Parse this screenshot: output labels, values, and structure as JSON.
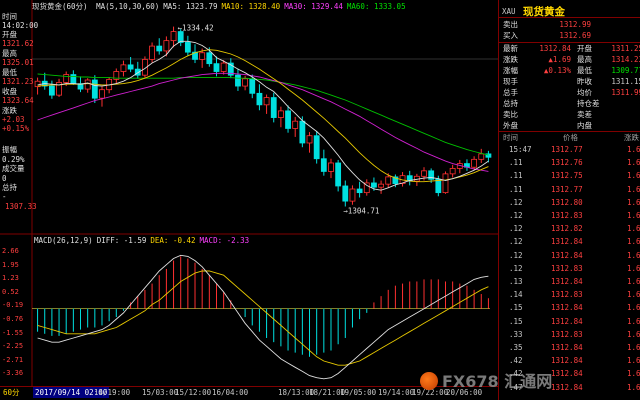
{
  "header": {
    "title": "现货黄金(60分)",
    "ma_labels": [
      {
        "text": "MA(5,10,30,60)",
        "color": "#e0e0e0"
      },
      {
        "text": "MA5: 1323.79",
        "color": "#e0e0e0"
      },
      {
        "text": "MA10: 1328.40",
        "color": "#ffd700"
      },
      {
        "text": "MA30: 1329.44",
        "color": "#ff40ff"
      },
      {
        "text": "MA60: 1333.05",
        "color": "#00e000"
      }
    ]
  },
  "left_info": {
    "time_label": "时间",
    "time_value": "14:02:00",
    "open_label": "开盘",
    "open_value": "1321.62",
    "high_label": "最高",
    "high_value": "1325.01",
    "low_label": "最低",
    "low_value": "1321.23",
    "close_label": "收盘",
    "close_value": "1323.64",
    "change_label": "涨跌",
    "change_value": "+2.03",
    "pct_value": "+0.15%",
    "amplitude_label": "振幅",
    "amplitude_value": "0.29%",
    "volume_label": "成交量",
    "volume_value": "0",
    "hold_label": "总持",
    "hold_value": "-",
    "marker_price": "1307.33"
  },
  "price_axis": [
    "1335.31",
    "1321.62",
    "1325.01",
    "1321.23",
    "1323.64",
    "+2.03",
    "+0.15%",
    "0.29%"
  ],
  "chart_annotations": {
    "peak": "1334.42",
    "trough": "1304.71"
  },
  "macd": {
    "header": [
      {
        "text": "MACD(26,12,9)",
        "color": "#e0e0e0"
      },
      {
        "text": "DIFF: -1.59",
        "color": "#e0e0e0"
      },
      {
        "text": "DEA: -0.42",
        "color": "#ffd700"
      },
      {
        "text": "MACD: -2.33",
        "color": "#ff40ff"
      }
    ],
    "axis": [
      "2.66",
      "1.95",
      "1.23",
      "0.52",
      "-0.19",
      "-0.76",
      "-1.55",
      "-2.25",
      "-2.71",
      "-3.36"
    ]
  },
  "footer": {
    "period": "60分",
    "cursor_date": "2017/09/14 02:00",
    "x_labels": [
      "14/19:00",
      "15/03:00",
      "15/12:00",
      "16/04:00",
      "18/13:00",
      "18/21:00",
      "19/05:00",
      "19/14:00",
      "19/22:00",
      "20/06:00"
    ]
  },
  "quote_panel": {
    "code": "XAU",
    "name": "现货黄金",
    "sell": {
      "label": "卖出",
      "value": "1312.99"
    },
    "buy": {
      "label": "买入",
      "value": "1312.69"
    },
    "rows": [
      {
        "l1": "最新",
        "v1": "1312.84",
        "l2": "开盘",
        "v2": "1311.25",
        "c1": "#ff4040",
        "c2": "#ff4040"
      },
      {
        "l1": "涨跌",
        "v1": "▲1.69",
        "l2": "最高",
        "v2": "1314.23",
        "c1": "#ff4040",
        "c2": "#ff4040"
      },
      {
        "l1": "涨幅",
        "v1": "▲0.13%",
        "l2": "最低",
        "v2": "1309.77",
        "c1": "#ff4040",
        "c2": "#00e000"
      },
      {
        "l1": "现手",
        "v1": "",
        "l2": "昨收",
        "v2": "1311.15",
        "c1": "#c8c8c8",
        "c2": "#c8c8c8"
      },
      {
        "l1": "总手",
        "v1": "",
        "l2": "均价",
        "v2": "1311.99",
        "c1": "#c8c8c8",
        "c2": "#ff4040"
      },
      {
        "l1": "总持",
        "v1": "",
        "l2": "持仓差",
        "v2": "",
        "c1": "#c8c8c8",
        "c2": "#c8c8c8"
      },
      {
        "l1": "卖比",
        "v1": "",
        "l2": "卖差",
        "v2": "",
        "c1": "#c8c8c8",
        "c2": "#c8c8c8"
      },
      {
        "l1": "外盘",
        "v1": "",
        "l2": "内盘",
        "v2": "",
        "c1": "#c8c8c8",
        "c2": "#c8c8c8"
      }
    ],
    "tick_header": {
      "time": "时间",
      "price": "价格",
      "change": "涨跌"
    },
    "ticks": [
      {
        "t": "15:47",
        "p": "1312.77",
        "c": "1.62"
      },
      {
        "t": ".11",
        "p": "1312.76",
        "c": "1.61"
      },
      {
        "t": ".11",
        "p": "1312.75",
        "c": "1.60"
      },
      {
        "t": ".11",
        "p": "1312.77",
        "c": "1.62"
      },
      {
        "t": ".12",
        "p": "1312.80",
        "c": "1.65"
      },
      {
        "t": ".12",
        "p": "1312.83",
        "c": "1.68"
      },
      {
        "t": ".12",
        "p": "1312.82",
        "c": "1.67"
      },
      {
        "t": ".12",
        "p": "1312.84",
        "c": "1.69"
      },
      {
        "t": ".12",
        "p": "1312.84",
        "c": "1.69"
      },
      {
        "t": ".12",
        "p": "1312.83",
        "c": "1.68"
      },
      {
        "t": ".13",
        "p": "1312.84",
        "c": "1.69"
      },
      {
        "t": ".14",
        "p": "1312.83",
        "c": "1.68"
      },
      {
        "t": ".15",
        "p": "1312.84",
        "c": "1.69"
      },
      {
        "t": ".15",
        "p": "1312.84",
        "c": "1.69"
      },
      {
        "t": ".33",
        "p": "1312.83",
        "c": "1.68"
      },
      {
        "t": ".35",
        "p": "1312.84",
        "c": "1.69"
      },
      {
        "t": ".42",
        "p": "1312.84",
        "c": "1.69"
      },
      {
        "t": ".42",
        "p": "1312.84",
        "c": "1.69"
      },
      {
        "t": ".47",
        "p": "1312.84",
        "c": "1.69"
      }
    ]
  },
  "watermark": "FX678 汇通网",
  "chart_data": {
    "type": "candlestick",
    "candles": [
      [
        1324.5,
        1326.0,
        1323.2,
        1325.4
      ],
      [
        1325.4,
        1326.8,
        1324.0,
        1324.6
      ],
      [
        1324.6,
        1325.5,
        1322.5,
        1323.1
      ],
      [
        1323.1,
        1325.8,
        1322.8,
        1325.2
      ],
      [
        1325.2,
        1327.0,
        1324.6,
        1326.5
      ],
      [
        1326.5,
        1327.2,
        1324.8,
        1325.0
      ],
      [
        1325.0,
        1326.2,
        1323.6,
        1324.1
      ],
      [
        1324.1,
        1325.9,
        1323.5,
        1325.6
      ],
      [
        1325.6,
        1326.4,
        1321.8,
        1322.6
      ],
      [
        1322.6,
        1324.5,
        1321.2,
        1324.0
      ],
      [
        1324.0,
        1326.1,
        1323.4,
        1325.7
      ],
      [
        1325.7,
        1327.5,
        1325.0,
        1327.0
      ],
      [
        1327.0,
        1328.8,
        1326.2,
        1328.1
      ],
      [
        1328.1,
        1329.4,
        1326.9,
        1327.4
      ],
      [
        1327.4,
        1328.6,
        1325.8,
        1326.4
      ],
      [
        1326.4,
        1329.5,
        1326.0,
        1329.0
      ],
      [
        1329.0,
        1331.8,
        1328.5,
        1331.2
      ],
      [
        1331.2,
        1332.5,
        1329.8,
        1330.4
      ],
      [
        1330.4,
        1332.8,
        1329.5,
        1332.1
      ],
      [
        1332.1,
        1334.42,
        1331.0,
        1333.6
      ],
      [
        1333.6,
        1334.0,
        1331.2,
        1331.8
      ],
      [
        1331.8,
        1332.9,
        1329.6,
        1330.2
      ],
      [
        1330.2,
        1331.5,
        1328.4,
        1329.0
      ],
      [
        1329.0,
        1330.8,
        1327.6,
        1330.1
      ],
      [
        1330.1,
        1331.0,
        1327.8,
        1328.3
      ],
      [
        1328.3,
        1329.5,
        1326.2,
        1327.0
      ],
      [
        1327.0,
        1328.9,
        1326.5,
        1328.4
      ],
      [
        1328.4,
        1329.2,
        1325.9,
        1326.4
      ],
      [
        1326.4,
        1327.5,
        1323.8,
        1324.6
      ],
      [
        1324.6,
        1326.3,
        1323.9,
        1325.8
      ],
      [
        1325.8,
        1326.5,
        1322.6,
        1323.4
      ],
      [
        1323.4,
        1324.9,
        1320.6,
        1321.5
      ],
      [
        1321.5,
        1323.2,
        1320.0,
        1322.7
      ],
      [
        1322.7,
        1323.5,
        1318.6,
        1319.4
      ],
      [
        1319.4,
        1321.2,
        1317.8,
        1320.5
      ],
      [
        1320.5,
        1321.4,
        1316.9,
        1317.6
      ],
      [
        1317.6,
        1319.5,
        1316.2,
        1318.8
      ],
      [
        1318.8,
        1319.6,
        1314.5,
        1315.2
      ],
      [
        1315.2,
        1317.0,
        1313.6,
        1316.4
      ],
      [
        1316.4,
        1317.2,
        1311.8,
        1312.6
      ],
      [
        1312.6,
        1314.1,
        1309.8,
        1310.5
      ],
      [
        1310.5,
        1312.6,
        1309.4,
        1311.9
      ],
      [
        1311.9,
        1312.4,
        1307.2,
        1308.1
      ],
      [
        1308.1,
        1309.0,
        1304.71,
        1305.6
      ],
      [
        1305.6,
        1308.2,
        1305.0,
        1307.6
      ],
      [
        1307.6,
        1308.8,
        1306.2,
        1307.0
      ],
      [
        1307.0,
        1309.2,
        1306.5,
        1308.6
      ],
      [
        1308.6,
        1309.5,
        1307.3,
        1307.9
      ],
      [
        1307.9,
        1309.0,
        1306.8,
        1308.4
      ],
      [
        1308.4,
        1310.2,
        1307.8,
        1309.6
      ],
      [
        1309.6,
        1310.0,
        1307.9,
        1308.5
      ],
      [
        1308.5,
        1310.4,
        1308.0,
        1309.8
      ],
      [
        1309.8,
        1310.6,
        1308.2,
        1308.9
      ],
      [
        1308.9,
        1310.1,
        1308.1,
        1309.7
      ],
      [
        1309.7,
        1311.2,
        1309.0,
        1310.6
      ],
      [
        1310.6,
        1311.0,
        1308.6,
        1309.2
      ],
      [
        1309.2,
        1309.8,
        1306.4,
        1307.0
      ],
      [
        1307.0,
        1310.5,
        1306.8,
        1310.1
      ],
      [
        1310.1,
        1311.6,
        1309.5,
        1311.0
      ],
      [
        1311.0,
        1312.4,
        1310.2,
        1311.8
      ],
      [
        1311.8,
        1312.5,
        1310.6,
        1311.2
      ],
      [
        1311.2,
        1313.0,
        1310.8,
        1312.5
      ],
      [
        1312.5,
        1314.23,
        1311.9,
        1313.4
      ],
      [
        1313.4,
        1313.9,
        1312.0,
        1312.84
      ]
    ],
    "ma5": [
      1324.8,
      1325.0,
      1324.9,
      1324.8,
      1325.0,
      1325.0,
      1324.9,
      1325.1,
      1324.7,
      1324.6,
      1324.8,
      1325.0,
      1325.4,
      1326.0,
      1326.8,
      1327.5,
      1328.4,
      1329.0,
      1329.8,
      1331.2,
      1332.0,
      1332.0,
      1331.8,
      1331.3,
      1330.5,
      1329.3,
      1328.7,
      1328.1,
      1327.4,
      1326.8,
      1326.1,
      1325.3,
      1324.4,
      1323.7,
      1322.5,
      1321.2,
      1320.1,
      1318.9,
      1318.0,
      1317.1,
      1316.0,
      1314.6,
      1313.2,
      1311.6,
      1310.3,
      1309.1,
      1308.2,
      1307.6,
      1307.4,
      1307.8,
      1308.3,
      1308.6,
      1309.0,
      1309.2,
      1309.4,
      1309.5,
      1309.3,
      1309.0,
      1309.3,
      1309.7,
      1310.2,
      1310.7,
      1311.4,
      1312.2
    ],
    "ma10": [
      1324.6,
      1324.7,
      1324.8,
      1324.8,
      1324.9,
      1324.9,
      1324.9,
      1325.0,
      1324.9,
      1324.8,
      1324.8,
      1324.9,
      1325.0,
      1325.2,
      1325.5,
      1325.9,
      1326.4,
      1327.0,
      1327.6,
      1328.3,
      1329.0,
      1329.6,
      1330.1,
      1330.4,
      1330.6,
      1330.5,
      1330.2,
      1329.9,
      1329.4,
      1328.8,
      1328.1,
      1327.4,
      1326.6,
      1325.8,
      1325.0,
      1324.1,
      1323.2,
      1322.3,
      1321.3,
      1320.3,
      1319.3,
      1318.2,
      1317.1,
      1316.0,
      1314.8,
      1313.6,
      1312.5,
      1311.5,
      1310.6,
      1309.9,
      1309.4,
      1309.1,
      1308.9,
      1308.8,
      1308.8,
      1308.9,
      1309.0,
      1309.1,
      1309.3,
      1309.6,
      1309.9,
      1310.3,
      1310.8,
      1311.3
    ],
    "ma30": [
      1319.0,
      1319.4,
      1319.8,
      1320.2,
      1320.6,
      1321.0,
      1321.4,
      1321.8,
      1322.2,
      1322.5,
      1322.8,
      1323.1,
      1323.4,
      1323.7,
      1324.0,
      1324.3,
      1324.6,
      1325.0,
      1325.3,
      1325.6,
      1325.9,
      1326.1,
      1326.3,
      1326.5,
      1326.6,
      1326.7,
      1326.7,
      1326.7,
      1326.6,
      1326.5,
      1326.3,
      1326.1,
      1325.8,
      1325.5,
      1325.2,
      1324.8,
      1324.4,
      1324.0,
      1323.5,
      1323.0,
      1322.5,
      1322.0,
      1321.4,
      1320.8,
      1320.2,
      1319.6,
      1318.9,
      1318.2,
      1317.5,
      1316.8,
      1316.1,
      1315.5,
      1314.9,
      1314.3,
      1313.7,
      1313.2,
      1312.7,
      1312.2,
      1311.8,
      1311.5,
      1311.2,
      1310.9,
      1310.7,
      1310.5
    ],
    "ma60": [
      1326.6,
      1326.5,
      1326.4,
      1326.3,
      1326.2,
      1326.2,
      1326.1,
      1326.1,
      1326.0,
      1326.0,
      1326.0,
      1325.9,
      1325.9,
      1325.9,
      1325.9,
      1325.9,
      1325.9,
      1325.9,
      1325.9,
      1325.9,
      1326.0,
      1326.0,
      1326.0,
      1326.0,
      1326.0,
      1326.0,
      1326.0,
      1326.0,
      1325.9,
      1325.9,
      1325.8,
      1325.7,
      1325.6,
      1325.4,
      1325.2,
      1325.0,
      1324.8,
      1324.5,
      1324.2,
      1323.9,
      1323.5,
      1323.1,
      1322.7,
      1322.3,
      1321.8,
      1321.3,
      1320.8,
      1320.3,
      1319.8,
      1319.3,
      1318.8,
      1318.3,
      1317.8,
      1317.3,
      1316.8,
      1316.3,
      1315.8,
      1315.3,
      1314.9,
      1314.5,
      1314.1,
      1313.8,
      1313.5,
      1313.2
    ],
    "ylim": [
      1300.5,
      1336.5
    ],
    "macd_hist": [
      -1.1,
      -1.2,
      -1.3,
      -1.3,
      -1.2,
      -1.1,
      -1.0,
      -0.9,
      -0.9,
      -0.8,
      -0.6,
      -0.4,
      -0.1,
      0.3,
      0.6,
      0.9,
      1.2,
      1.6,
      1.9,
      2.3,
      2.5,
      2.4,
      2.2,
      1.9,
      1.6,
      1.2,
      0.8,
      0.4,
      0.0,
      -0.4,
      -0.8,
      -1.1,
      -1.4,
      -1.6,
      -1.8,
      -2.0,
      -2.1,
      -2.2,
      -2.3,
      -2.2,
      -2.1,
      -2.0,
      -1.7,
      -1.4,
      -0.9,
      -0.5,
      -0.2,
      0.3,
      0.6,
      0.9,
      1.1,
      1.2,
      1.3,
      1.3,
      1.4,
      1.4,
      1.4,
      1.3,
      1.3,
      1.2,
      1.1,
      0.9,
      0.7,
      0.5
    ],
    "diff": [
      -1.4,
      -1.5,
      -1.6,
      -1.6,
      -1.5,
      -1.4,
      -1.3,
      -1.2,
      -1.1,
      -1.0,
      -0.8,
      -0.5,
      -0.2,
      0.2,
      0.6,
      1.0,
      1.4,
      1.8,
      2.1,
      2.4,
      2.55,
      2.5,
      2.3,
      2.0,
      1.6,
      1.2,
      0.8,
      0.3,
      -0.2,
      -0.7,
      -1.1,
      -1.5,
      -1.8,
      -2.1,
      -2.4,
      -2.6,
      -2.8,
      -3.0,
      -3.2,
      -3.3,
      -3.35,
      -3.3,
      -3.1,
      -2.8,
      -2.5,
      -2.2,
      -1.9,
      -1.6,
      -1.3,
      -1.0,
      -0.8,
      -0.6,
      -0.4,
      -0.2,
      0.0,
      0.2,
      0.4,
      0.6,
      0.8,
      1.0,
      1.2,
      1.4,
      1.5,
      1.55
    ],
    "dea": [
      -0.8,
      -0.9,
      -1.0,
      -1.1,
      -1.2,
      -1.2,
      -1.2,
      -1.2,
      -1.2,
      -1.1,
      -1.0,
      -0.9,
      -0.7,
      -0.5,
      -0.3,
      -0.1,
      0.2,
      0.4,
      0.7,
      1.0,
      1.3,
      1.5,
      1.7,
      1.8,
      1.8,
      1.7,
      1.6,
      1.3,
      1.0,
      0.7,
      0.4,
      0.1,
      -0.2,
      -0.5,
      -0.8,
      -1.1,
      -1.4,
      -1.7,
      -2.0,
      -2.3,
      -2.5,
      -2.6,
      -2.7,
      -2.7,
      -2.6,
      -2.5,
      -2.3,
      -2.1,
      -1.9,
      -1.7,
      -1.5,
      -1.3,
      -1.1,
      -0.9,
      -0.7,
      -0.5,
      -0.3,
      -0.1,
      0.1,
      0.3,
      0.5,
      0.7,
      0.9,
      1.05
    ],
    "macd_ylim": [
      -3.6,
      2.9
    ]
  }
}
